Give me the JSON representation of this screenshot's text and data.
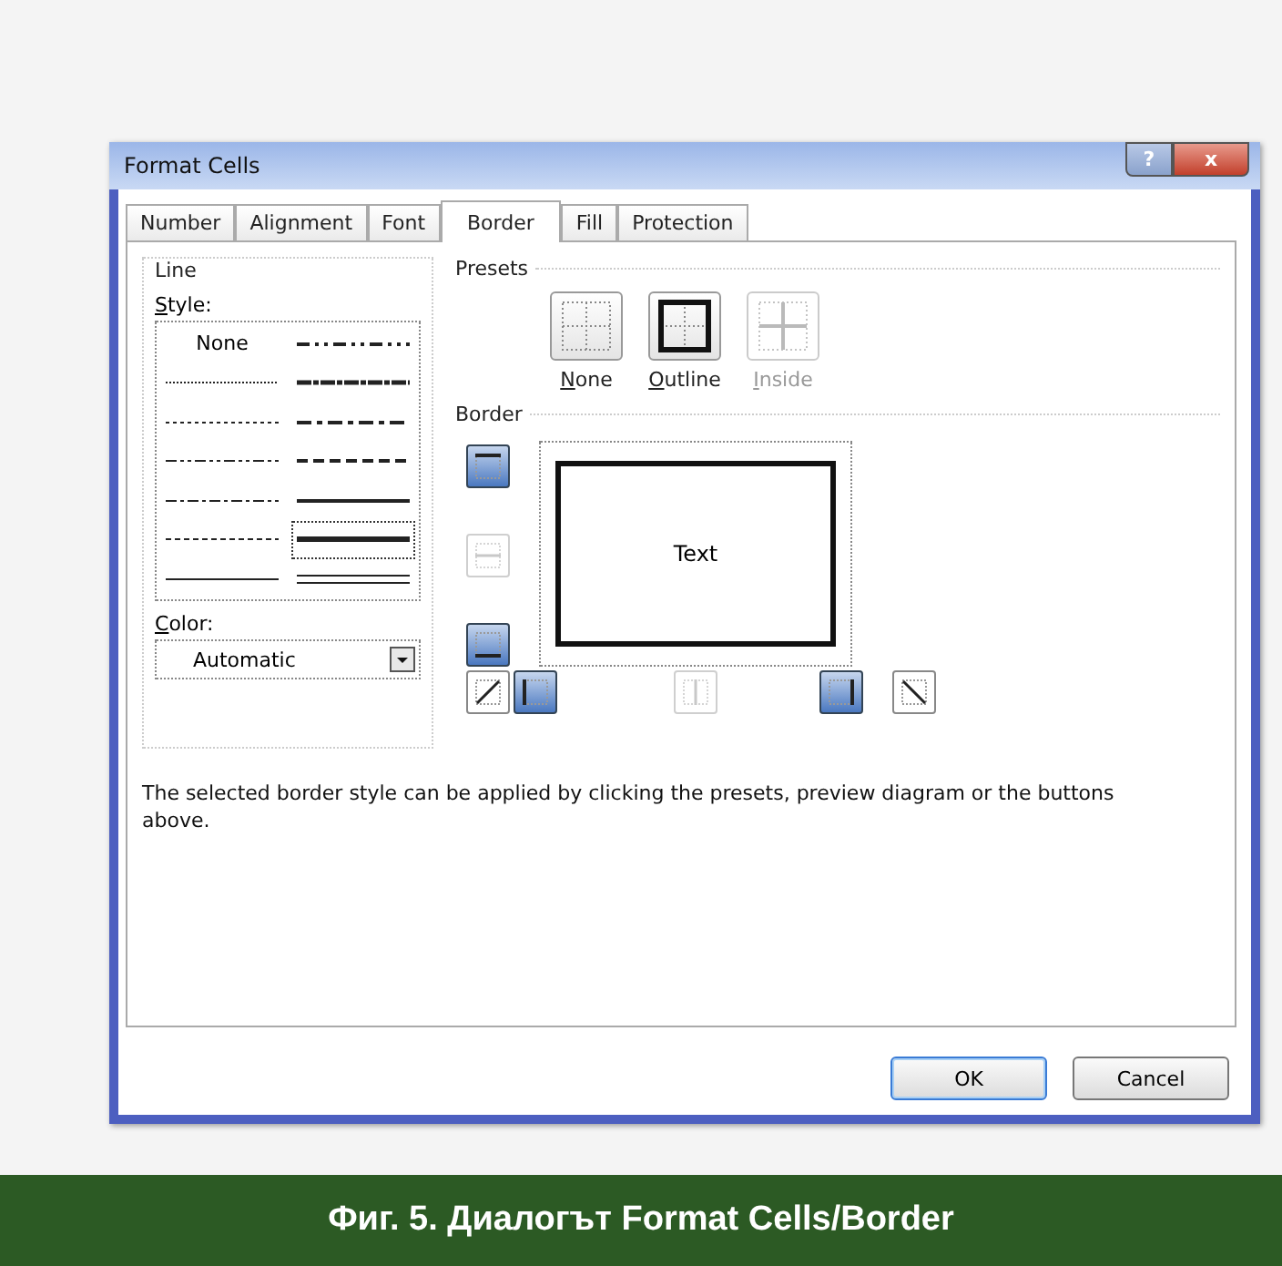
{
  "window": {
    "title": "Format Cells",
    "help_button": "?",
    "close_button": "x"
  },
  "tabs": [
    {
      "label": "Number",
      "selected": false
    },
    {
      "label": "Alignment",
      "selected": false
    },
    {
      "label": "Font",
      "selected": false
    },
    {
      "label": "Border",
      "selected": true
    },
    {
      "label": "Fill",
      "selected": false
    },
    {
      "label": "Protection",
      "selected": false
    }
  ],
  "line": {
    "title": "Line",
    "style_label": "Style:",
    "styles": [
      {
        "kind": "none",
        "label": "None",
        "selected": false
      },
      {
        "kind": "hair",
        "selected": false
      },
      {
        "kind": "dotted",
        "selected": false
      },
      {
        "kind": "dashdotdot",
        "selected": false
      },
      {
        "kind": "dashdot",
        "selected": false
      },
      {
        "kind": "dashed",
        "selected": false
      },
      {
        "kind": "thin",
        "selected": false
      },
      {
        "kind": "mediumdashdotdot",
        "selected": false
      },
      {
        "kind": "slantdashdot",
        "selected": false
      },
      {
        "kind": "mediumdashdot",
        "selected": false
      },
      {
        "kind": "mediumdashed",
        "selected": false
      },
      {
        "kind": "medium",
        "selected": false
      },
      {
        "kind": "thick",
        "selected": true
      },
      {
        "kind": "double",
        "selected": false
      }
    ],
    "color_label": "Color:",
    "color_value": "Automatic"
  },
  "presets": {
    "title": "Presets",
    "items": [
      {
        "kind": "none",
        "label": "None",
        "disabled": false
      },
      {
        "kind": "outline",
        "label": "Outline",
        "disabled": false
      },
      {
        "kind": "inside",
        "label": "Inside",
        "disabled": true
      }
    ]
  },
  "border": {
    "title": "Border",
    "preview_text": "Text",
    "buttons": [
      {
        "kind": "top",
        "on": true,
        "disabled": false
      },
      {
        "kind": "middle",
        "on": false,
        "disabled": true
      },
      {
        "kind": "bottom",
        "on": true,
        "disabled": false
      },
      {
        "kind": "diagup",
        "on": false,
        "disabled": false
      },
      {
        "kind": "left",
        "on": true,
        "disabled": false
      },
      {
        "kind": "center",
        "on": false,
        "disabled": true
      },
      {
        "kind": "right",
        "on": true,
        "disabled": false
      },
      {
        "kind": "diagdown",
        "on": false,
        "disabled": false
      }
    ]
  },
  "help_text": "The selected border style can be applied by clicking the presets, preview diagram or the buttons above.",
  "buttons": [
    {
      "label": "OK",
      "default": true
    },
    {
      "label": "Cancel",
      "default": false
    }
  ],
  "caption": "Фиг. 5. Диалогът Format Cells/Border"
}
